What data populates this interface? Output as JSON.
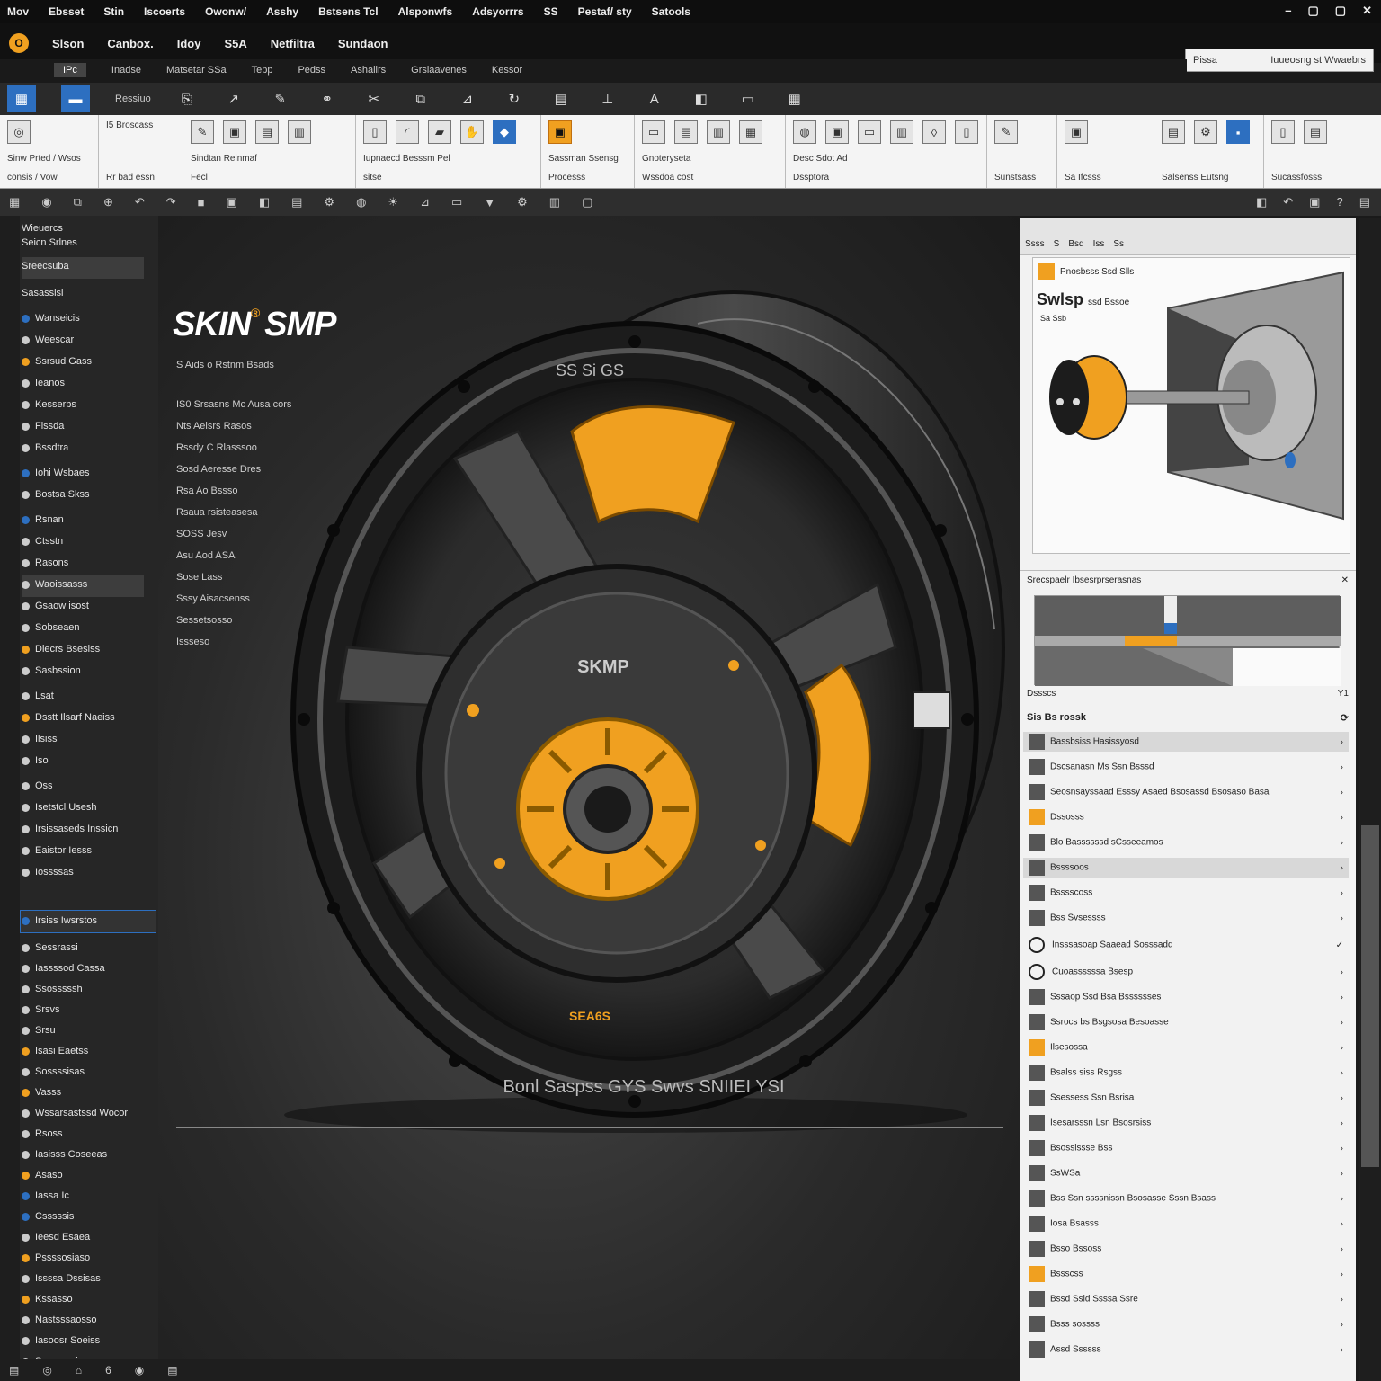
{
  "menubar": {
    "items": [
      "Mov",
      "Ebsset",
      "Stin",
      "Iscoerts",
      "Owonw/",
      "Asshy",
      "Bstsens Tcl",
      "Alsponwfs",
      "Adsyorrrs",
      "SS",
      "Pestaf/ sty",
      "Satools"
    ],
    "window_controls": [
      "–",
      "▢",
      "▢",
      "✕"
    ]
  },
  "titlebar": {
    "logo": "O",
    "items": [
      "Slson",
      "Canbox.",
      "Idoy",
      "S5A",
      "Netfiltra",
      "Sundaon"
    ]
  },
  "search": {
    "label": "Pissa",
    "placeholder": "Iuueosng st Wwaebrs"
  },
  "tabs": [
    "IPc",
    "Inadse",
    "Matsetar SSa",
    "Tepp",
    "Pedss",
    "Ashalirs",
    "Grsiaavenes",
    "Kessor"
  ],
  "ribbon_top_label": "Ressiuo",
  "ribbon_groups": [
    {
      "label": "Sinw Prted / Wsos",
      "sub": "consis / Vow"
    },
    {
      "label": "I5 Broscass",
      "sub": "Rr bad essn"
    },
    {
      "label": "Sindtan Reinmaf",
      "sub": "Fecl"
    },
    {
      "label": "Iupnaecd Besssm Pel",
      "sub": "sitse"
    },
    {
      "label": "Sassman Ssensg",
      "sub": "Processs"
    },
    {
      "label": "Gnoteryseta",
      "sub": "Wssdoa cost"
    },
    {
      "label": "Desc Sdot Ad",
      "sub": "Dssptora"
    },
    {
      "label": "Sunstsass",
      "sub": "Sa"
    },
    {
      "label": "Sa Ifcsss",
      "sub": ""
    },
    {
      "label": "Salsenss Eutsng",
      "sub": ""
    },
    {
      "label": "Sucassfosss",
      "sub": ""
    }
  ],
  "sidebar": {
    "header": "Wieuercs",
    "sub": "Seicn Srlnes",
    "folder": "Sreecsuba",
    "folder_sub": "Sasassisi",
    "items": [
      "Wanseicis",
      "Weescar",
      "Ssrsud Gass",
      "Ieanos",
      "Kesserbs",
      "Fissda",
      "Bssdtra",
      "Iohi Wsbaes",
      "Bostsa Skss",
      "Rsnan",
      "Ctsstn",
      "Rasons",
      "Waoissasss",
      "Gsaow isost",
      "Sobseaen",
      "Diecrs Bsesiss",
      "Sasbssion",
      "Lsat",
      "Dsstt Ilsarf Naeiss",
      "Ilsiss",
      "Iso",
      "Oss",
      "Isetstcl Usesh",
      "Irsissaseds Inssicn",
      "Eaistor Iesss",
      "Iossssas"
    ],
    "selected": "Irsiss Iwsrstos",
    "items2": [
      "Sessrassi",
      "Iassssod Cassa",
      "Ssosssssh",
      "Srsvs",
      "Srsu",
      "Isasi Eaetss",
      "Sossssisas",
      "Vasss",
      "Wssarsastssd Wocor",
      "Rsoss",
      "Iasisss Coseeas",
      "Asaso",
      "Iassa Ic",
      "Csssssis",
      "Ieesd Esaea",
      "Pssssosiaso",
      "Issssa Dssisas",
      "Kssasso",
      "Nastsssaosso",
      "Iasoosr Soeiss",
      "Sassa seissss"
    ]
  },
  "viewport": {
    "brand": "SKIN",
    "brand_mark": "®",
    "brand2": "SMP",
    "lines": [
      "S Aids   o   Rstnm   Bsads",
      "IS0 Srsasns Mc Ausa   cors",
      "Nts Aeisrs Rasos",
      "Rssdy C Rlasssoo",
      "Sosd Aeresse Dres",
      "Rsa Ao   Bssso",
      "Rsaua rsisteasesa",
      "SOSS   Jesv",
      "Asu Aod   ASA",
      "Sose   Lass",
      "Sssy Aisacsenss",
      "Sessetsosso",
      "Issseso"
    ],
    "hub_label": "SKMP",
    "rim_top": "SS  Si   GS",
    "rim_bottom": "Bonl Saspss GYS Swvs   SNIIEI YSI",
    "rim_tag": "SEA6S"
  },
  "rpanel": {
    "head": [
      "Ssss",
      "S",
      "Bsd",
      "Iss",
      "Ss"
    ],
    "preview_title": "Pnosbsss Ssd Slls",
    "preview_name": "Swlsp",
    "preview_name2": "ssd Bssoe",
    "preview_sub": "Sa Ssb",
    "section2": "Srecspaelr Ibsesrprserasnas",
    "section2_foot": "Dssscs",
    "section2_foot2": "Y1",
    "props_head": "Sis  Bs  rossk",
    "rows": [
      "Bassbsiss Hasissyosd",
      "Dscsanasn Ms Ssn Bsssd",
      "Seosnsayssaad Esssy Asaed Bsosassd Bsosaso Basa",
      "Dssosss",
      "Blo Bassssssd sCsseeamos",
      "Bssssoos",
      "Bsssscoss",
      "Bss Svsessss",
      "Insssasoap Saaead Sosssadd",
      "Cuoassssssa Bsesp",
      "Sssaop Ssd Bsa Bsssssses",
      "Ssrocs bs Bsgsosa Besoasse",
      "Ilsesossa",
      "Bsalss siss Rsgss",
      "Ssessess Ssn Bsrisa",
      "Isesarsssn Lsn Bsosrsiss",
      "Bsosslssse Bss",
      "SsWSa",
      "Bss Ssn ssssnissn Bsosasse Sssn Bsass",
      "Iosa Bsasss",
      "Bsso Bssoss",
      "Bssscss",
      "Bssd Ssld Ssssa Ssre",
      "Bsss sossss",
      "Assd Ssssss"
    ]
  },
  "status": [
    "▤",
    "◎",
    "⌂",
    "6",
    "◉",
    "▤"
  ]
}
